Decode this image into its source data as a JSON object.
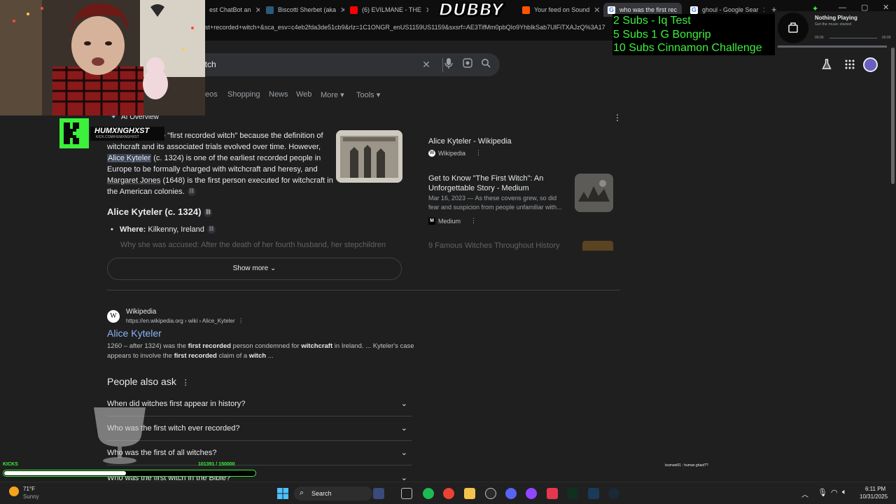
{
  "tabs": [
    {
      "label": "est ChatBot an",
      "color": "#5f6368"
    },
    {
      "label": "Biscotti Sherbet (aka",
      "color": "#7fb3d5"
    },
    {
      "label": "(6) EVILMANE - THE",
      "color": "#ff0000"
    },
    {
      "label": "",
      "color": "#4285f4"
    },
    {
      "label": "Your feed on Sound",
      "color": "#ff5500"
    },
    {
      "label": "who was the first rec",
      "color": "#4285f4"
    },
    {
      "label": "ghoul - Google Sear",
      "color": "#4285f4"
    }
  ],
  "tab_close": "✕",
  "new_tab": "+",
  "url": "rst+recorded+witch+&sca_esv=c4eb2fda3de51cb9&rlz=1C1ONGR_enUS1159US1159&sxsrf=AE3TifMm0pbQIo9YhbIkSab7UlFiTXAJzQ%3A17",
  "search": {
    "query": "itch"
  },
  "nav_tabs": [
    "eos",
    "Shopping",
    "News",
    "Web",
    "More",
    "Tools"
  ],
  "ai_overview": {
    "label": "AI Overview",
    "p1a": "e \"first recorded witch\" because the definition of",
    "p1b": "witchcraft and its associated trials evolved over time. However,",
    "p1c_highlight": "Alice Kyteler",
    "p1c_rest": " (c. 1324) is one of the earliest recorded people in",
    "p1d": "Europe to be formally charged with witchcraft and heresy, and",
    "p1e_name": "Margaret Jones",
    "p1e_rest": " (1648) is the first person executed for witchcraft in",
    "p1f": "the American colonies.",
    "heading": "Alice Kyteler (c. 1324)",
    "where_label": "Where:",
    "where_value": " Kilkenny, Ireland",
    "why_line": "Why she was accused: After the death of her fourth husband, her stepchildren",
    "show_more": "Show more"
  },
  "sources": [
    {
      "title": "Alice Kyteler - Wikipedia",
      "site": "Wikipedia"
    },
    {
      "title": "Get to Know \"The First Witch\": An Unforgettable Story - Medium",
      "snippet": "Mar 16, 2023 — As these covens grew, so did fear and suspicion from people unfamiliar with...",
      "site": "Medium"
    },
    {
      "title": "9 Famous Witches Throughout History"
    }
  ],
  "result": {
    "site": "Wikipedia",
    "url": "https://en.wikipedia.org › wiki › Alice_Kyteler",
    "title": "Alice Kyteler",
    "snippet_a": "1260 – after 1324) was the ",
    "snippet_b": "first recorded",
    "snippet_c": " person condemned for ",
    "snippet_d": "witchcraft",
    "snippet_e": " in Ireland. ... Kyteler's case",
    "snippet_f": "appears to involve the ",
    "snippet_g": "first recorded",
    "snippet_h": " claim of a ",
    "snippet_i": "witch",
    "snippet_j": " ..."
  },
  "paa": {
    "heading": "People also ask",
    "questions": [
      "When did witches first appear in history?",
      "Who was the first witch ever recorded?",
      "Who was the first of all witches?",
      "Who was the first witch in the Bible?"
    ]
  },
  "overlay": {
    "dubby": "DUBBY",
    "subs": [
      "2 Subs - Iq Test",
      "5 Subs 1 G Bongrip",
      "10 Subs Cinnamon Challenge"
    ],
    "now_playing_title": "Nothing Playing",
    "now_playing_sub": "Get the music started",
    "time_start": "00:00",
    "time_end": "00:00",
    "streamer_name": "HUMXNGHXST",
    "streamer_handle": "KICK.COM/HUMXNGHXST",
    "goal_label": "KICKS",
    "goal_value": "101391 / 150000",
    "goal_fraction": 0.676,
    "chat_line": "tzumani01 : human ghast??"
  },
  "taskbar": {
    "weather_temp": "71°F",
    "weather_desc": "Sunny",
    "search_label": "Search",
    "time": "6:11 PM",
    "date": "10/31/2025"
  },
  "colors": {
    "link": "#8ab4f8",
    "page_bg": "#1f1f1f",
    "green": "#3cf03c"
  }
}
